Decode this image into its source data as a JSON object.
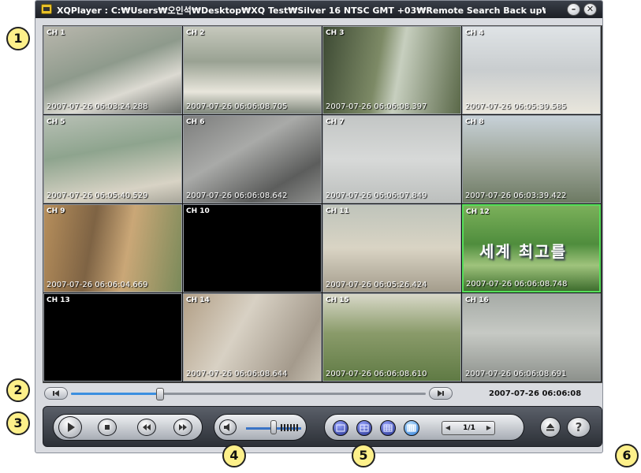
{
  "window": {
    "title": "XQPlayer : C:₩Users₩오인석₩Desktop₩XQ Test₩Silver 16 NTSC GMT +03₩Remote Search Back up₩₩XQ Te",
    "minimize_label": "–",
    "close_label": "✕"
  },
  "channels": [
    {
      "label": "CH 1",
      "timestamp": "2007-07-26 06:03:24.288",
      "scene": "meeting-room"
    },
    {
      "label": "CH 2",
      "timestamp": "2007-07-26 06:06:08.705",
      "scene": "office"
    },
    {
      "label": "CH 3",
      "timestamp": "2007-07-26 06:06:08.397",
      "scene": "trees"
    },
    {
      "label": "CH 4",
      "timestamp": "2007-07-26 06:05:39.585",
      "scene": "corridor"
    },
    {
      "label": "CH 5",
      "timestamp": "2007-07-26 06:05:40.529",
      "scene": "lab"
    },
    {
      "label": "CH 6",
      "timestamp": "2007-07-26 06:06:08.642",
      "scene": "hallway-gray"
    },
    {
      "label": "CH 7",
      "timestamp": "2007-07-26 06:06:07.849",
      "scene": "doors"
    },
    {
      "label": "CH 8",
      "timestamp": "2007-07-26 06:03:39.422",
      "scene": "city"
    },
    {
      "label": "CH 9",
      "timestamp": "2007-07-26 06:06:04.669",
      "scene": "apartments"
    },
    {
      "label": "CH 10",
      "timestamp": "",
      "scene": "black"
    },
    {
      "label": "CH 11",
      "timestamp": "2007-07-26 06:05:26.424",
      "scene": "reception"
    },
    {
      "label": "CH 12",
      "timestamp": "2007-07-26 06:06:08.748",
      "scene": "tv",
      "overlay": "세계 최고를"
    },
    {
      "label": "CH 13",
      "timestamp": "",
      "scene": "black"
    },
    {
      "label": "CH 14",
      "timestamp": "2007-07-26 06:06:08.644",
      "scene": "corridor-people"
    },
    {
      "label": "CH 15",
      "timestamp": "2007-07-26 06:06:08.610",
      "scene": "park"
    },
    {
      "label": "CH 16",
      "timestamp": "2007-07-26 06:06:08.691",
      "scene": "server-room"
    }
  ],
  "selected_channel": "CH 12",
  "timeline": {
    "position_fraction": 0.25,
    "current_time": "2007-07-26 06:06:08"
  },
  "controls": {
    "volume_fraction": 0.5,
    "page_indicator": "1/1",
    "layout_options": [
      "single",
      "quad",
      "nine",
      "sixteen"
    ],
    "active_layout": "sixteen"
  },
  "callouts": [
    "1",
    "2",
    "3",
    "4",
    "5",
    "6"
  ],
  "icons": {
    "play": "play-icon",
    "stop": "stop-icon",
    "rewind": "rewind-icon",
    "forward": "fast-forward-icon",
    "mute": "speaker-icon",
    "eject": "eject-icon",
    "help": "help-icon",
    "timeline_start": "skip-start-icon",
    "timeline_end": "skip-end-icon"
  },
  "colors": {
    "selection": "#55e05a",
    "callout": "#fdf08a",
    "accent": "#3b8fe0"
  }
}
